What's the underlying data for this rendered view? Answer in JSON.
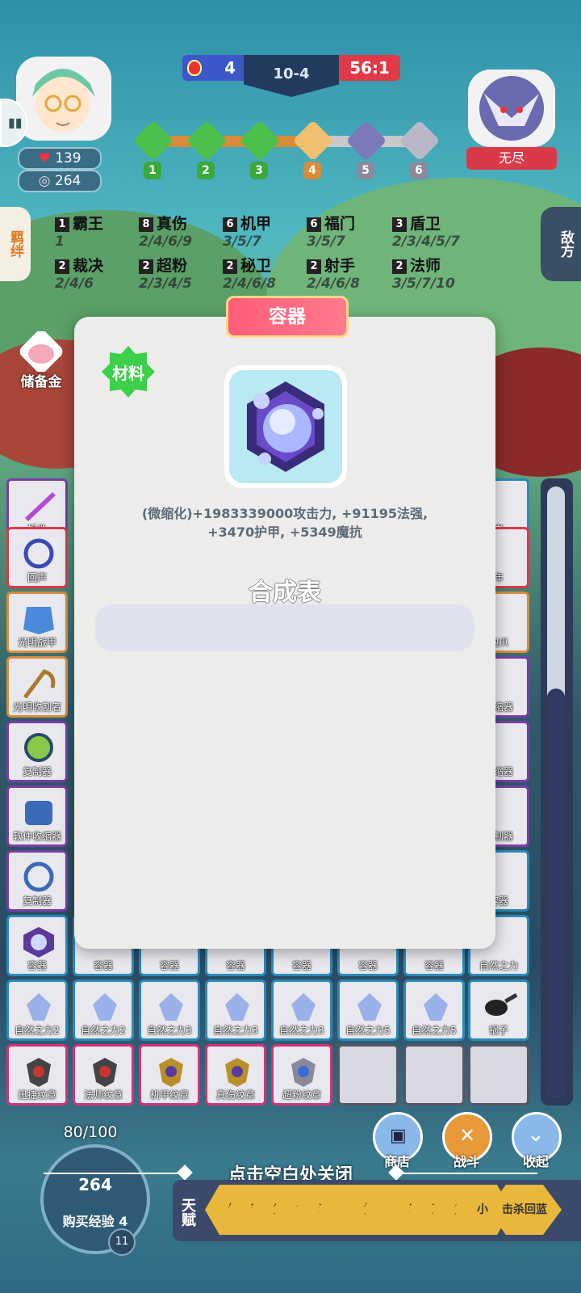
{
  "hud": {
    "my_score": "4",
    "stage": "10-4",
    "enemy_score": "56:1",
    "hp": "139",
    "gold": "264",
    "enemy_name": "无尽",
    "rounds": [
      "1",
      "2",
      "3",
      "4",
      "5",
      "6"
    ]
  },
  "side": {
    "left_tab": "羁绊",
    "right_tab": "敌方",
    "reserve_label": "储备金"
  },
  "synergies": [
    {
      "lv": "1",
      "name": "霸王",
      "tiers": "1"
    },
    {
      "lv": "8",
      "name": "真伤",
      "tiers": "2/4/6/9"
    },
    {
      "lv": "6",
      "name": "机甲",
      "tiers": "3/5/7"
    },
    {
      "lv": "6",
      "name": "福门",
      "tiers": "3/5/7"
    },
    {
      "lv": "3",
      "name": "盾卫",
      "tiers": "2/3/4/5/7"
    },
    {
      "lv": "2",
      "name": "裁决",
      "tiers": "2/4/6"
    },
    {
      "lv": "2",
      "name": "超粉",
      "tiers": "2/3/4/5"
    },
    {
      "lv": "2",
      "name": "秘卫",
      "tiers": "2/4/6/8"
    },
    {
      "lv": "2",
      "name": "射手",
      "tiers": "2/4/6/8"
    },
    {
      "lv": "2",
      "name": "法师",
      "tiers": "3/5/7/10"
    }
  ],
  "grid_items": {
    "left_col": [
      "拆件",
      "回声",
      "光明战甲",
      "光明收割者",
      "复制器",
      "软件收缩器",
      "复制器",
      "容器"
    ],
    "right_col": [
      "书",
      "年",
      "泡爪",
      "收缩器",
      "收缩器",
      "复制器",
      "容器",
      "自然之力"
    ],
    "row_containers": [
      "容器",
      "容器",
      "容器",
      "容器",
      "容器",
      "容器"
    ],
    "row_nature": [
      "自然之力2",
      "自然之力2",
      "自然之力3",
      "自然之力3",
      "自然之力3",
      "自然之力5",
      "自然之力5",
      "锅子"
    ],
    "row_emblems": [
      "迅捷纹章",
      "法师纹章",
      "机甲纹章",
      "真伤纹章",
      "超粉纹章"
    ]
  },
  "modal": {
    "title": "容器",
    "badge": "材料",
    "description_line1": "(微缩化)+1983339000攻击力, +91195法强,",
    "description_line2": "+3470护甲, +5349魔抗",
    "recipe_title": "合成表"
  },
  "bottom": {
    "close_hint": "点击空白处关闭",
    "xp_progress": "80/100",
    "xp_gold": "264",
    "buy_xp_label": "购买经验 4",
    "level": "11",
    "shop_label": "商店",
    "battle_label": "战斗",
    "collapse_label": "收起",
    "talent_tag": "天赋",
    "talents": [
      "饮",
      "利",
      "重",
      "备",
      "装",
      "【",
      "护",
      "勺",
      "装",
      "正",
      "斧",
      "小",
      "击杀回蓝"
    ]
  },
  "colors": {
    "modal_bg": "#ececea",
    "title_banner": "#ff5c78",
    "material_badge": "#3ccf4a"
  }
}
